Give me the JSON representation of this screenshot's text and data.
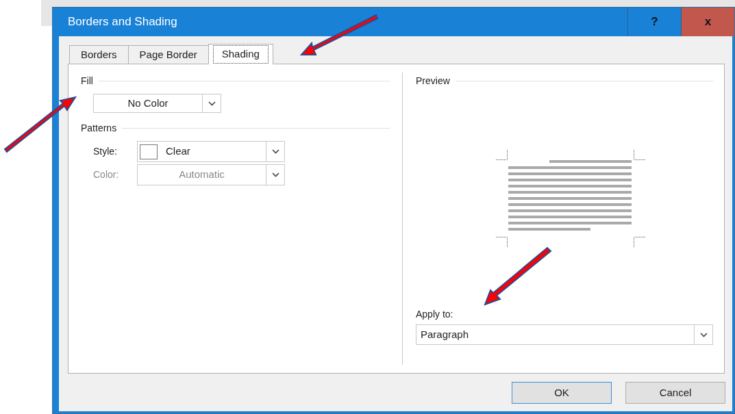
{
  "window": {
    "title": "Borders and Shading",
    "buttons": [
      {
        "kind": "help",
        "label": "?"
      },
      {
        "kind": "close",
        "label": "x"
      }
    ]
  },
  "tabs": [
    {
      "label": "Borders",
      "selected": false
    },
    {
      "label": "Page Border",
      "selected": false
    },
    {
      "label": "Shading",
      "selected": true
    }
  ],
  "fill": {
    "title": "Fill",
    "dropdown": {
      "value": "No Color"
    }
  },
  "patterns": {
    "title": "Patterns",
    "fields": [
      {
        "label": "Style:",
        "value": "Clear",
        "disabled": false,
        "kind": "swatch"
      },
      {
        "label": "Color:",
        "value": "Automatic",
        "disabled": true,
        "kind": "plain"
      }
    ]
  },
  "preview": {
    "title": "Preview",
    "apply_to": {
      "label": "Apply to:",
      "value": "Paragraph"
    }
  },
  "buttons": [
    {
      "label": "OK",
      "kind": "default"
    },
    {
      "label": "Cancel",
      "kind": "normal"
    }
  ]
}
